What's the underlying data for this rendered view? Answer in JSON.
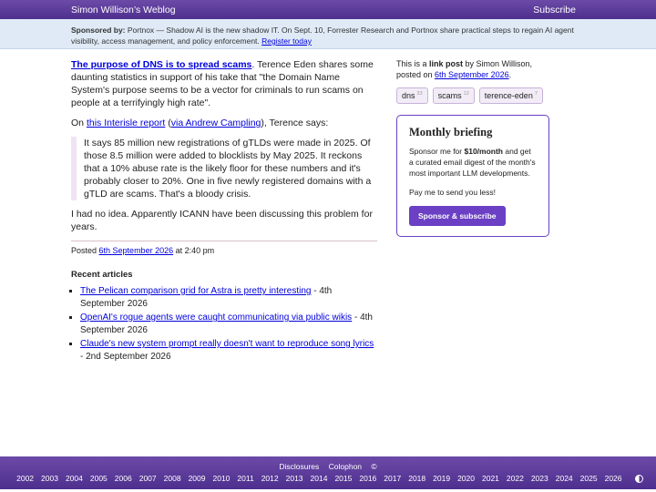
{
  "header": {
    "site_title": "Simon Willison’s Weblog",
    "subscribe": "Subscribe"
  },
  "sponsor": {
    "label": "Sponsored by:",
    "text": " Portnox — Shadow AI is the new shadow IT. On Sept. 10, Forrester Research and Portnox share practical steps to regain AI agent visibility, access management, and policy enforcement. ",
    "link": "Register today"
  },
  "entry": {
    "title": "The purpose of DNS is to spread scams",
    "intro": ". Terence Eden shares some daunting statistics in support of his take that \"the Domain Name System's purpose seems to be a vector for criminals to run scams on people at a terrifyingly high rate\".",
    "on_text": "On ",
    "report_link": "this Interisle report",
    "via_open": " (",
    "via_link": "via Andrew Campling",
    "via_close": "), Terence says:",
    "quote": "It says 85 million new registrations of gTLDs were made in 2025. Of those 8.5 million were added to blocklists by May 2025. It reckons that a 10% abuse rate is the likely floor for these numbers and it's probably closer to 20%. One in five newly registered domains with a gTLD are scams. That's a bloody crisis.",
    "closing": "I had no idea. Apparently ICANN have been discussing this problem for years.",
    "posted_prefix": "Posted ",
    "posted_date": "6th September 2026",
    "posted_time": " at 2:40 pm"
  },
  "recent": {
    "heading": "Recent articles",
    "items": [
      {
        "title": "The Pelican comparison grid for Astra is pretty interesting",
        "date": " - 4th September 2026"
      },
      {
        "title": "OpenAI's rogue agents were caught communicating via public wikis",
        "date": " - 4th September 2026"
      },
      {
        "title": "Claude's new system prompt really doesn't want to reproduce song lyrics",
        "date": " - 2nd September 2026"
      }
    ]
  },
  "sidebar": {
    "meta_prefix": "This is a ",
    "meta_bold": "link post",
    "meta_by": " by Simon Willison, posted on ",
    "meta_date": "6th September 2026",
    "meta_end": ".",
    "tags": [
      {
        "name": "dns",
        "count": "33"
      },
      {
        "name": "scams",
        "count": "12"
      },
      {
        "name": "terence-eden",
        "count": "7"
      }
    ]
  },
  "briefing": {
    "title": "Monthly briefing",
    "text_before": "Sponsor me for ",
    "price": "$10/month",
    "text_after": " and get a curated email digest of the month's most important LLM developments.",
    "pay_text": "Pay me to send you less!",
    "button": "Sponsor & subscribe"
  },
  "footer": {
    "disclosures": "Disclosures",
    "colophon": "Colophon",
    "copyright": "©",
    "years": [
      "2002",
      "2003",
      "2004",
      "2005",
      "2006",
      "2007",
      "2008",
      "2009",
      "2010",
      "2011",
      "2012",
      "2013",
      "2014",
      "2015",
      "2016",
      "2017",
      "2018",
      "2019",
      "2020",
      "2021",
      "2022",
      "2023",
      "2024",
      "2025",
      "2026"
    ],
    "theme_icon": "contrast-icon"
  }
}
